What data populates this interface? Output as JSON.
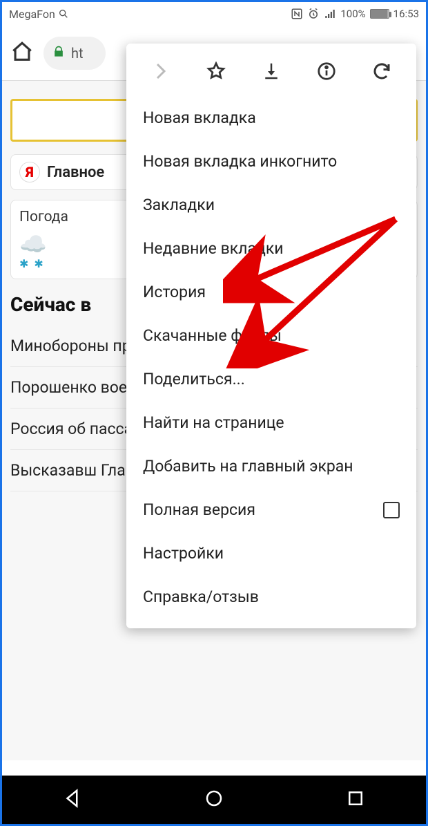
{
  "status": {
    "carrier": "MegaFon",
    "battery_pct": "100%",
    "time": "16:53"
  },
  "browser": {
    "url_prefix": "ht"
  },
  "page": {
    "tab_main": "Главное",
    "weather_label": "Погода",
    "section_title": "Сейчас в",
    "news": [
      "Минобороны провело п",
      "Порошенко военного",
      "Россия об пассажир",
      "Высказавш Глацких п"
    ]
  },
  "menu": {
    "items": [
      "Новая вкладка",
      "Новая вкладка инкогнито",
      "Закладки",
      "Недавние вкладки",
      "История",
      "Скачанные файлы",
      "Поделиться...",
      "Найти на странице",
      "Добавить на главный экран",
      "Полная версия",
      "Настройки",
      "Справка/отзыв"
    ]
  }
}
